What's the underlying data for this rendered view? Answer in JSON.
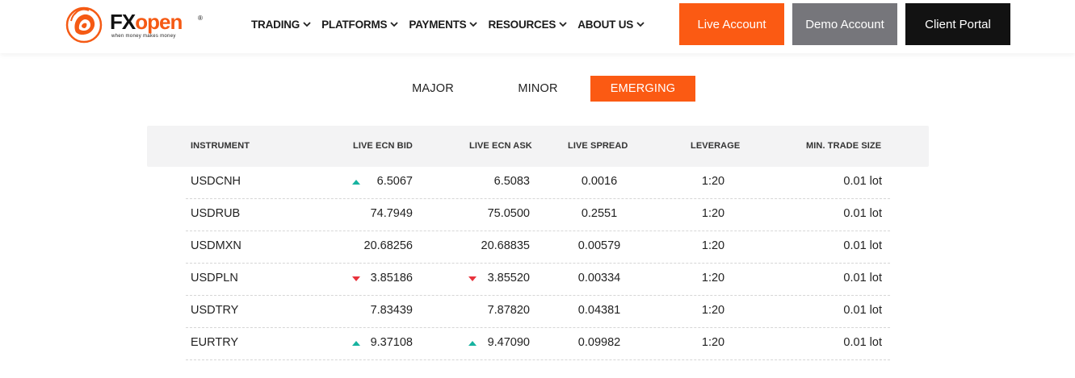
{
  "header": {
    "logo": {
      "brand_fx": "FX",
      "brand_open": "open",
      "reg": "®",
      "tagline": "when money makes money"
    },
    "nav": [
      {
        "label": "TRADING"
      },
      {
        "label": "PLATFORMS"
      },
      {
        "label": "PAYMENTS"
      },
      {
        "label": "RESOURCES"
      },
      {
        "label": "ABOUT US"
      }
    ],
    "buttons": {
      "live": "Live Account",
      "demo": "Demo Account",
      "portal": "Client Portal"
    }
  },
  "tabs": {
    "major": "MAJOR",
    "minor": "MINOR",
    "emerging": "EMERGING",
    "active": "EMERGING"
  },
  "table": {
    "headers": {
      "instrument": "INSTRUMENT",
      "bid": "LIVE ECN BID",
      "ask": "LIVE ECN ASK",
      "spread": "LIVE SPREAD",
      "leverage": "LEVERAGE",
      "min_size": "MIN. TRADE SIZE"
    },
    "rows": [
      {
        "instrument": "USDCNH",
        "bid": "6.5067",
        "bid_dir": "up",
        "ask": "6.5083",
        "ask_dir": "",
        "spread": "0.0016",
        "leverage": "1:20",
        "min_size": "0.01 lot"
      },
      {
        "instrument": "USDRUB",
        "bid": "74.7949",
        "bid_dir": "",
        "ask": "75.0500",
        "ask_dir": "",
        "spread": "0.2551",
        "leverage": "1:20",
        "min_size": "0.01 lot"
      },
      {
        "instrument": "USDMXN",
        "bid": "20.68256",
        "bid_dir": "",
        "ask": "20.68835",
        "ask_dir": "",
        "spread": "0.00579",
        "leverage": "1:20",
        "min_size": "0.01 lot"
      },
      {
        "instrument": "USDPLN",
        "bid": "3.85186",
        "bid_dir": "down",
        "ask": "3.85520",
        "ask_dir": "down",
        "spread": "0.00334",
        "leverage": "1:20",
        "min_size": "0.01 lot"
      },
      {
        "instrument": "USDTRY",
        "bid": "7.83439",
        "bid_dir": "",
        "ask": "7.87820",
        "ask_dir": "",
        "spread": "0.04381",
        "leverage": "1:20",
        "min_size": "0.01 lot"
      },
      {
        "instrument": "EURTRY",
        "bid": "9.37108",
        "bid_dir": "up",
        "ask": "9.47090",
        "ask_dir": "up",
        "spread": "0.09982",
        "leverage": "1:20",
        "min_size": "0.01 lot"
      }
    ]
  },
  "colors": {
    "accent": "#fb5a13",
    "demo_button": "#76767b",
    "portal_button": "#121212",
    "up_arrow": "#17b3a0",
    "down_arrow": "#e8323c"
  }
}
